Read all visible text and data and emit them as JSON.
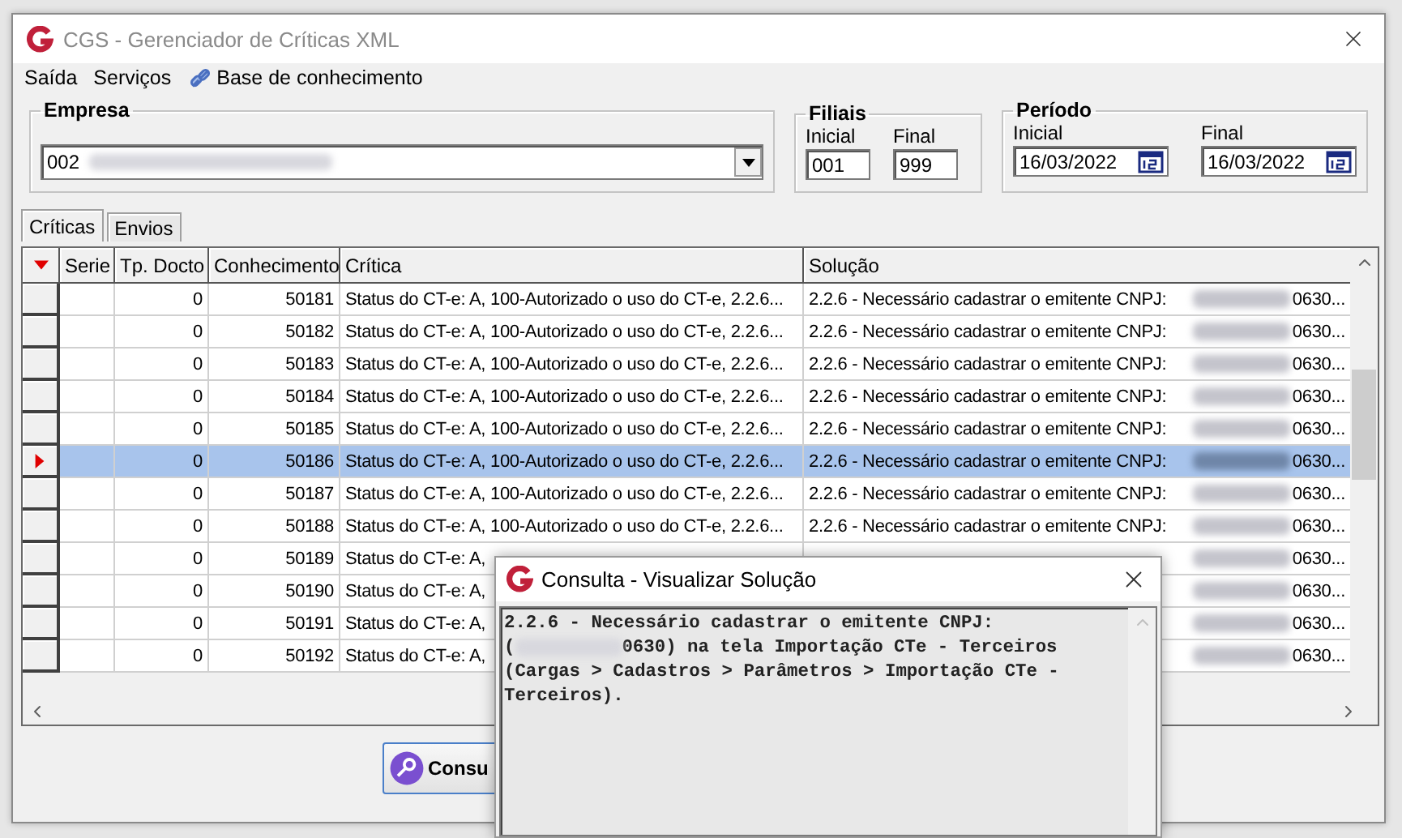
{
  "window": {
    "title": "CGS - Gerenciador de Críticas XML"
  },
  "menu": [
    {
      "label": "Saída",
      "kind": "text"
    },
    {
      "label": "Serviços",
      "kind": "text"
    },
    {
      "label": "Base de conhecimento",
      "kind": "icon"
    }
  ],
  "empresa": {
    "legend": "Empresa",
    "value": "002"
  },
  "filiais": {
    "legend": "Filiais",
    "fields": [
      {
        "label": "Inicial",
        "value": "001"
      },
      {
        "label": "Final",
        "value": "999"
      }
    ]
  },
  "periodo": {
    "legend": "Período",
    "fields": [
      {
        "label": "Inicial",
        "value": "16/03/2022"
      },
      {
        "label": "Final",
        "value": "16/03/2022"
      }
    ]
  },
  "tabs": [
    {
      "label": "Críticas",
      "selected": true
    },
    {
      "label": "Envios",
      "selected": false
    }
  ],
  "table": {
    "columns": [
      "Serie",
      "Tp. Docto",
      "Conhecimento",
      "Crítica",
      "Solução"
    ],
    "rows": [
      {
        "tp_docto": "0",
        "conhecimento": "50181",
        "critica": "Status do CT-e: A, 100-Autorizado o uso do CT-e, 2.2.6...",
        "solucao": "2.2.6 - Necessário cadastrar o emitente CNPJ:",
        "solucao_end": "0630...",
        "selected": false
      },
      {
        "tp_docto": "0",
        "conhecimento": "50182",
        "critica": "Status do CT-e: A, 100-Autorizado o uso do CT-e, 2.2.6...",
        "solucao": "2.2.6 - Necessário cadastrar o emitente CNPJ:",
        "solucao_end": "0630...",
        "selected": false
      },
      {
        "tp_docto": "0",
        "conhecimento": "50183",
        "critica": "Status do CT-e: A, 100-Autorizado o uso do CT-e, 2.2.6...",
        "solucao": "2.2.6 - Necessário cadastrar o emitente CNPJ:",
        "solucao_end": "0630...",
        "selected": false
      },
      {
        "tp_docto": "0",
        "conhecimento": "50184",
        "critica": "Status do CT-e: A, 100-Autorizado o uso do CT-e, 2.2.6...",
        "solucao": "2.2.6 - Necessário cadastrar o emitente CNPJ:",
        "solucao_end": "0630...",
        "selected": false
      },
      {
        "tp_docto": "0",
        "conhecimento": "50185",
        "critica": "Status do CT-e: A, 100-Autorizado o uso do CT-e, 2.2.6...",
        "solucao": "2.2.6 - Necessário cadastrar o emitente CNPJ:",
        "solucao_end": "0630...",
        "selected": false
      },
      {
        "tp_docto": "0",
        "conhecimento": "50186",
        "critica": "Status do CT-e: A, 100-Autorizado o uso do CT-e, 2.2.6...",
        "solucao": "2.2.6 - Necessário cadastrar o emitente CNPJ:",
        "solucao_end": "0630...",
        "selected": true
      },
      {
        "tp_docto": "0",
        "conhecimento": "50187",
        "critica": "Status do CT-e: A, 100-Autorizado o uso do CT-e, 2.2.6...",
        "solucao": "2.2.6 - Necessário cadastrar o emitente CNPJ:",
        "solucao_end": "0630...",
        "selected": false
      },
      {
        "tp_docto": "0",
        "conhecimento": "50188",
        "critica": "Status do CT-e: A, 100-Autorizado o uso do CT-e, 2.2.6...",
        "solucao": "2.2.6 - Necessário cadastrar o emitente CNPJ:",
        "solucao_end": "0630...",
        "selected": false
      },
      {
        "tp_docto": "0",
        "conhecimento": "50189",
        "critica": "Status do CT-e: A,",
        "solucao_end": "0630...",
        "selected": false
      },
      {
        "tp_docto": "0",
        "conhecimento": "50190",
        "critica": "Status do CT-e: A,",
        "solucao_end": "0630...",
        "selected": false
      },
      {
        "tp_docto": "0",
        "conhecimento": "50191",
        "critica": "Status do CT-e: A,",
        "solucao_end": "0630...",
        "selected": false
      },
      {
        "tp_docto": "0",
        "conhecimento": "50192",
        "critica": "Status do CT-e: A,",
        "solucao_end": "0630...",
        "selected": false
      }
    ]
  },
  "button": {
    "label": "Consu"
  },
  "dialog": {
    "title": "Consulta -  Visualizar Solução",
    "lines": [
      {
        "kind": "text",
        "text": "2.2.6 - Necessário cadastrar o emitente CNPJ:"
      },
      {
        "kind": "redacted",
        "before": "(",
        "text": "0630) na tela Importação CTe - Terceiros"
      },
      {
        "kind": "text",
        "text": "(Cargas > Cadastros > Parâmetros > Importação CTe -"
      },
      {
        "kind": "text",
        "text": "Terceiros)."
      }
    ]
  }
}
